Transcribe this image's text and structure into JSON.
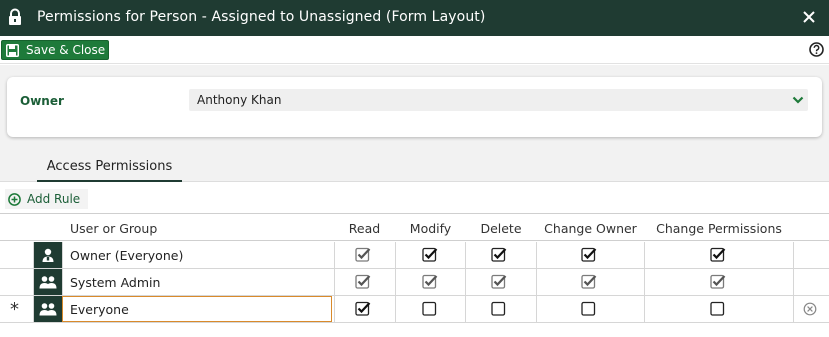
{
  "window": {
    "title": "Permissions for Person - Assigned to Unassigned (Form Layout)",
    "lock_icon": "lock-icon",
    "close_icon": "close-icon"
  },
  "toolbar": {
    "save_label": "Save & Close",
    "help_icon": "help-icon"
  },
  "owner": {
    "label": "Owner",
    "value": "Anthony Khan"
  },
  "tabs": [
    {
      "label": "Access Permissions",
      "active": true
    }
  ],
  "add_rule_label": "Add Rule",
  "grid": {
    "columns": [
      "User or Group",
      "Read",
      "Modify",
      "Delete",
      "Change Owner",
      "Change Permissions"
    ],
    "rows": [
      {
        "name": "Owner (Everyone)",
        "type": "owner",
        "read": true,
        "modify": true,
        "delete": true,
        "change_owner": true,
        "change_permissions": true,
        "enabled": [
          false,
          true,
          true,
          true,
          true
        ]
      },
      {
        "name": "System Admin",
        "type": "group",
        "read": true,
        "modify": true,
        "delete": true,
        "change_owner": true,
        "change_permissions": true,
        "enabled": [
          false,
          false,
          false,
          false,
          false
        ]
      },
      {
        "name": "Everyone",
        "type": "group",
        "read": true,
        "modify": false,
        "delete": false,
        "change_owner": false,
        "change_permissions": false,
        "enabled": [
          true,
          true,
          true,
          true,
          true
        ],
        "editing": true,
        "marker": "*"
      }
    ]
  },
  "colors": {
    "titlebar": "#1f3b32",
    "accent_green": "#1e7a3a",
    "label_green": "#1b5e37",
    "edit_border": "#d98a2b"
  }
}
